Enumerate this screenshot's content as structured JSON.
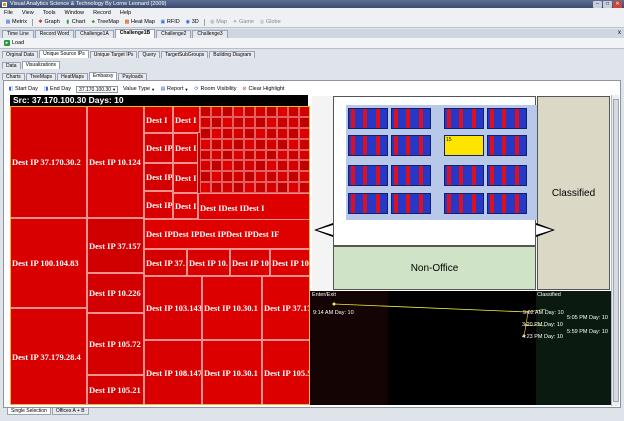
{
  "window": {
    "title": "Visual Analytics Science & Technology By Lorne Leonard (2009)"
  },
  "menu": [
    "File",
    "View",
    "Tools",
    "Window",
    "Record",
    "Help"
  ],
  "toolbar": [
    {
      "label": "Metrix",
      "icon": "metrix-icon",
      "enabled": true
    },
    {
      "label": "Graph",
      "icon": "graph-icon",
      "enabled": true
    },
    {
      "label": "Chart",
      "icon": "chart-icon",
      "enabled": true
    },
    {
      "label": "TreeMap",
      "icon": "treemap-icon",
      "enabled": true
    },
    {
      "label": "Heat Map",
      "icon": "heatmap-icon",
      "enabled": true
    },
    {
      "label": "RFID",
      "icon": "rfid-icon",
      "enabled": true
    },
    {
      "label": "3D",
      "icon": "3d-icon",
      "enabled": true
    },
    {
      "label": "Map",
      "icon": "map-icon",
      "enabled": false
    },
    {
      "label": "Game",
      "icon": "game-icon",
      "enabled": false
    },
    {
      "label": "Globe",
      "icon": "globe-icon",
      "enabled": false
    }
  ],
  "doc_tabs": [
    {
      "label": "Time Line",
      "active": false
    },
    {
      "label": "Record Word",
      "active": false
    },
    {
      "label": "Challenge1A",
      "active": false
    },
    {
      "label": "Challenge1B",
      "active": true
    },
    {
      "label": "Challenge2",
      "active": false
    },
    {
      "label": "Challenge3",
      "active": false
    }
  ],
  "doc_close": "x",
  "load_button": "Load",
  "tabs_row1": [
    {
      "label": "Orginal Data",
      "active": false
    },
    {
      "label": "Unique Source IPs",
      "active": true
    },
    {
      "label": "Unique Target IPs",
      "active": false
    },
    {
      "label": "Query",
      "active": false
    },
    {
      "label": "TargetSubGroups",
      "active": false
    },
    {
      "label": "Building Diagram",
      "active": false
    }
  ],
  "tabs_row2": [
    {
      "label": "Data",
      "active": false
    },
    {
      "label": "Visualizations",
      "active": true
    }
  ],
  "tabs_row3": [
    {
      "label": "Charts",
      "active": false
    },
    {
      "label": "TreeMaps",
      "active": false
    },
    {
      "label": "HeatMaps",
      "active": false
    },
    {
      "label": "Embassy",
      "active": true
    },
    {
      "label": "Payloads",
      "active": false
    }
  ],
  "subbar": {
    "start_day": "Start Day",
    "end_day": "End Day",
    "ip_value": "37.170.100.30",
    "value_type": "Value Type",
    "report": "Report",
    "room_visibility": "Room Visibility",
    "clear_highlight": "Clear Highlight"
  },
  "treemap": {
    "header": "Src: 37.170.100.30 Days: 10",
    "base_color": "#b80000",
    "labeled_cells": [
      {
        "label": "Dest IP 37.170.30.2",
        "color": "#d40000"
      },
      {
        "label": "Dest IP 10.124",
        "color": "#d80000"
      },
      {
        "label": "Dest I",
        "color": "#dd0000"
      },
      {
        "label": "Dest I",
        "color": "#e00000"
      },
      {
        "label": "Dest IP 100.104.83",
        "color": "#d80000"
      },
      {
        "label": "Dest IP 37.157",
        "color": "#d00000"
      },
      {
        "label": "Dest IP",
        "color": "#d60000"
      },
      {
        "label": "Dest I",
        "color": "#da0000"
      },
      {
        "label": "Dest IP",
        "color": "#d40000"
      },
      {
        "label": "Dest I",
        "color": "#d80000"
      },
      {
        "label": "Dest IP 10.226",
        "color": "#d20000"
      },
      {
        "label": "Dest IP",
        "color": "#d80000"
      },
      {
        "label": "Dest I",
        "color": "#dc0000"
      },
      {
        "label": "Dest IDest IDest I",
        "color": "#de0000"
      },
      {
        "label": "Dest IPDest IPDest IPDest IPDest IF",
        "color": "#df0000"
      },
      {
        "label": "Dest IP 37.",
        "color": "#d40000"
      },
      {
        "label": "Dest IP 10.",
        "color": "#d80000"
      },
      {
        "label": "Dest IP 10.",
        "color": "#d80000"
      },
      {
        "label": "Dest IP 10.",
        "color": "#dc0000"
      },
      {
        "label": "Dest IP 37.179.28.4",
        "color": "#d80000"
      },
      {
        "label": "Dest IP 105.72",
        "color": "#d40000"
      },
      {
        "label": "Dest IP 103.143",
        "color": "#d80000"
      },
      {
        "label": "Dest IP 10.30.1",
        "color": "#dc0000"
      },
      {
        "label": "Dest IP 37.17",
        "color": "#dc0000"
      },
      {
        "label": "Dest IP 105.21",
        "color": "#d40000"
      },
      {
        "label": "Dest IP 108.147.",
        "color": "#d80000"
      },
      {
        "label": "Dest IP 10.30.1",
        "color": "#dc0000"
      },
      {
        "label": "Dest IP 105.57.",
        "color": "#dc0000"
      }
    ]
  },
  "floorplan": {
    "classified_label": "Classified",
    "non_office_label": "Non-Office",
    "highlight_room_label": "15",
    "room_color": "#2738c7",
    "accent_color": "#dd1020",
    "highlight_color": "#ffe400"
  },
  "timeline": {
    "enter_exit_label": "Enter/Exit",
    "classified_label": "Classified",
    "events": [
      {
        "label": "9:14 AM Day: 10"
      },
      {
        "label": "9:02 AM Day: 10"
      },
      {
        "label": "5:05 PM Day: 10"
      },
      {
        "label": "3:20 PM Day: 10"
      },
      {
        "label": "5:59 PM Day: 10"
      },
      {
        "label": "4:23 PM Day: 10"
      }
    ]
  },
  "bottom_tabs": [
    {
      "label": "Single Selection",
      "active": true
    },
    {
      "label": "Offices A + B",
      "active": false
    }
  ]
}
